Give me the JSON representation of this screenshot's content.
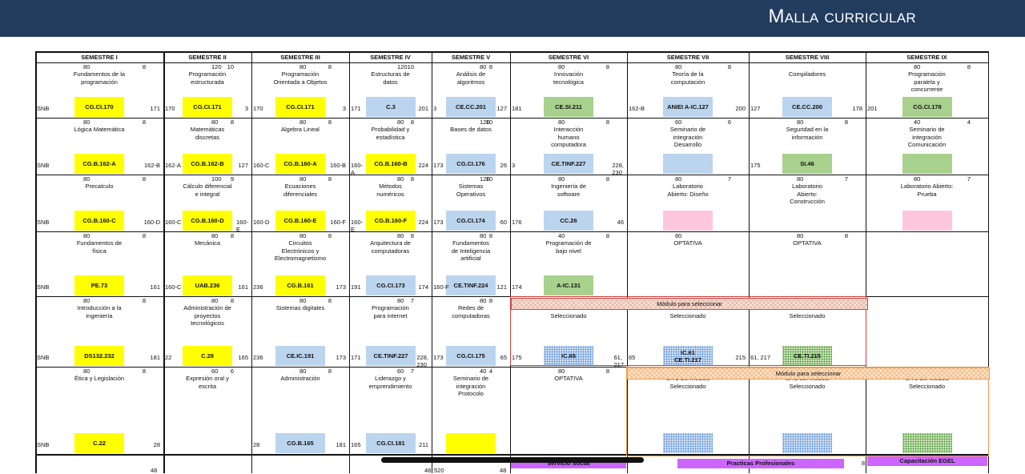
{
  "title": "Malla curricular",
  "colors": {
    "yellow": "#ffff00",
    "blue": "#bcd5ee",
    "green": "#a9d18e",
    "pink": "#ffc7dc",
    "purple": "#cc66ff",
    "header_bg": "#223c5e"
  },
  "headers": [
    "SEMESTRE I",
    "SEMESTRE II",
    "SEMESTRE III",
    "SEMESTRE IV",
    "SEMESTRE V",
    "SEMESTRE VI",
    "SEMESTRE VII",
    "SEMESTRE VIII",
    "SEMESTRE IX"
  ],
  "rows": [
    [
      {
        "hl": "80",
        "hr": "8",
        "name": "Fundamentos de la\nprogramación",
        "code": "CG.CI.170",
        "color": "yellow",
        "bl": "SNB",
        "br": "171"
      },
      {
        "hl": "120",
        "hr": "10",
        "name": "Programación\nestructurada",
        "code": "CG.CI.171",
        "color": "yellow",
        "bl": "170",
        "br": "3"
      },
      {
        "hl": "80",
        "hr": "8",
        "name": "Programación\nOrientada a Objetos",
        "code": "CG.CI.171",
        "color": "yellow",
        "bl": "170",
        "br": "3"
      },
      {
        "hl": "120",
        "hr": "10",
        "name": "Estructuras de\ndatos",
        "code": "C.3",
        "color": "blue",
        "bl": "171",
        "br": "201"
      },
      {
        "hl": "80",
        "hr": "8",
        "name": "Análisis de\nalgoritmos",
        "code": "CE.CC.201",
        "color": "blue",
        "bl": "3",
        "br": "127"
      },
      {
        "hl": "80",
        "hr": "8",
        "name": "Innovación\ntecnológica",
        "code": "CE.SI.211",
        "color": "green",
        "bl": "181",
        "br": ""
      },
      {
        "hl": "80",
        "hr": "8",
        "name": "Teoría de la\ncomputación",
        "code": "ANIEI A-IC.127",
        "color": "blue",
        "bl": "162-B",
        "br": "200"
      },
      {
        "hl": "",
        "hr": "",
        "name": "Compiladores",
        "code": "CE.CC.200",
        "color": "blue",
        "bl": "127",
        "br": "178"
      },
      {
        "hl": "80",
        "hr": "8",
        "name": "Programación\nparalela y\nconcurrente",
        "code": "CG.CI.178",
        "color": "green",
        "bl": "201",
        "br": ""
      }
    ],
    [
      {
        "hl": "80",
        "hr": "8",
        "name": "Lógica Matemática",
        "code": "CG.B.162-A",
        "color": "yellow",
        "bl": "SNB",
        "br": "162-B"
      },
      {
        "hl": "80",
        "hr": "8",
        "name": "Matemáticas\ndiscretas",
        "code": "CG.B.162-B",
        "color": "yellow",
        "bl": "162-A",
        "br": "127"
      },
      {
        "hl": "80",
        "hr": "8",
        "name": "Algebra Lineal",
        "code": "CG.B.160-A",
        "color": "yellow",
        "bl": "160-C",
        "br": "160-B"
      },
      {
        "hl": "80",
        "hr": "8",
        "name": "Probabilidad y\nestadística",
        "code": "CG.B.160-B",
        "color": "yellow",
        "bl": "160-\nA",
        "br": "224"
      },
      {
        "hl": "120",
        "hr": "10",
        "name": "Bases de datos",
        "code": "CG.CI.176",
        "color": "blue",
        "bl": "173",
        "br": "26"
      },
      {
        "hl": "80",
        "hr": "8",
        "name": "Interacción\nhumano\ncomputadora",
        "code": "CE.TINF.227",
        "color": "blue",
        "bl": "3",
        "br": "228,\n230"
      },
      {
        "hl": "60",
        "hr": "6",
        "name": "Seminario de\nintegración\nDesarrollo",
        "code": "",
        "color": "blue",
        "bl": "",
        "br": ""
      },
      {
        "hl": "80",
        "hr": "8",
        "name": "Seguridad en la\ninformación",
        "code": "SI.46",
        "color": "green",
        "bl": "175",
        "br": ""
      },
      {
        "hl": "40",
        "hr": "4",
        "name": "Seminario de\nintegración\nComunicación",
        "code": "",
        "color": "green",
        "bl": "",
        "br": ""
      }
    ],
    [
      {
        "hl": "80",
        "hr": "8",
        "name": "Precalculo",
        "code": "CG.B.160-C",
        "color": "yellow",
        "bl": "SNB",
        "br": "160-D"
      },
      {
        "hl": "100",
        "hr": "9",
        "name": "Cálculo diferencial\ne integral",
        "code": "CG.B.160-D",
        "color": "yellow",
        "bl": "160-C",
        "br": "160-\nE"
      },
      {
        "hl": "80",
        "hr": "8",
        "name": "Ecuaciones\ndiferenciales",
        "code": "CG.B.160-E",
        "color": "yellow",
        "bl": "160-D",
        "br": "160-F"
      },
      {
        "hl": "80",
        "hr": "8",
        "name": "Métodos\nnuméricos",
        "code": "CG.B.160-F",
        "color": "yellow",
        "bl": "160-\nE",
        "br": "224"
      },
      {
        "hl": "120",
        "hr": "10",
        "name": "Sistemas\nOperativos",
        "code": "CG.CI.174",
        "color": "blue",
        "bl": "173",
        "br": "60"
      },
      {
        "hl": "80",
        "hr": "8",
        "name": "Ingeniería de\nsoftware",
        "code": "CC.26",
        "color": "blue",
        "bl": "176",
        "br": "46"
      },
      {
        "hl": "80",
        "hr": "7",
        "name": "Laboratorio\nAbierto: Diseño",
        "code": "",
        "color": "pink",
        "bl": "",
        "br": ""
      },
      {
        "hl": "80",
        "hr": "7",
        "name": "Laboratorio\nAbierto:\nConstrucción",
        "code": "",
        "color": "",
        "bl": "",
        "br": ""
      },
      {
        "hl": "80",
        "hr": "7",
        "name": "Laboratorio Abierto:\nPrueba",
        "code": "",
        "color": "pink",
        "bl": "",
        "br": ""
      }
    ],
    [
      {
        "hl": "80",
        "hr": "8",
        "name": "Fundamentos de\nfísica",
        "code": "PE.73",
        "color": "yellow",
        "bl": "SNB",
        "br": "161"
      },
      {
        "hl": "80",
        "hr": "8",
        "name": "Mecánica",
        "code": "UAB.236",
        "color": "yellow",
        "bl": "160-C",
        "br": "161"
      },
      {
        "hl": "80",
        "hr": "8",
        "name": "Circuitos\nElectrónicos y\nElectromagnetismo",
        "code": "CG.B.161",
        "color": "yellow",
        "bl": "236",
        "br": "173"
      },
      {
        "hl": "80",
        "hr": "8",
        "name": "Arquitectura de\ncomputadoras",
        "code": "CG.CI.173",
        "color": "blue",
        "bl": "191",
        "br": "174"
      },
      {
        "hl": "80",
        "hr": "8",
        "name": "Fundamentos\nde Inteligencia\nartificial",
        "code": "CE.TINF.224",
        "color": "blue",
        "bl": "160-F",
        "br": "121"
      },
      {
        "hl": "40",
        "hr": "8",
        "name": "Programación de\nbajo nivel",
        "code": "A-IC.131",
        "color": "green",
        "bl": "174",
        "br": ""
      },
      {
        "hl": "80",
        "hr": "",
        "name": "OPTATIVA",
        "code": "",
        "color": "",
        "bl": "",
        "br": ""
      },
      {
        "hl": "80",
        "hr": "8",
        "name": "OPTATIVA",
        "code": "",
        "color": "",
        "bl": "",
        "br": ""
      },
      {
        "hl": "",
        "hr": "",
        "name": "",
        "code": "",
        "color": "",
        "bl": "",
        "br": ""
      }
    ],
    [
      {
        "hl": "80",
        "hr": "8",
        "name": "Introducción a la\ningeniería",
        "code": "DS132.232",
        "color": "yellow",
        "bl": "SNB",
        "br": "181"
      },
      {
        "hl": "80",
        "hr": "8",
        "name": "Administración de\nproyectos\ntecnológicos",
        "code": "C.28",
        "color": "yellow",
        "bl": "22",
        "br": "165"
      },
      {
        "hl": "80",
        "hr": "8",
        "name": "Sistemas digitales",
        "code": "CE.IC.191",
        "color": "blue",
        "bl": "236",
        "br": "173"
      },
      {
        "hl": "80",
        "hr": "7",
        "name": "Programación\npara internet",
        "code": "CE.TINF.227",
        "color": "blue",
        "bl": "171",
        "br": "228,\n230"
      },
      {
        "hl": "80",
        "hr": "8",
        "name": "Redes de\ncomputadoras",
        "code": "CG.CI.175",
        "color": "blue",
        "bl": "173",
        "br": "65"
      },
      {
        "hl": "80",
        "hr": "8",
        "name": "UA 1 del Módulo\nSeleccionado",
        "code": "IC.65",
        "color": "dots-blue",
        "bl": "175",
        "br": "61,\n217"
      },
      {
        "hl": "80",
        "hr": "8",
        "name": "UA 2 del Módulo\nSeleccionado",
        "code": "IC.61\nCE.TI.217",
        "color": "dots-blue",
        "bl": "65",
        "br": "215"
      },
      {
        "hl": "80",
        "hr": "8",
        "name": "UA 3 del Módulo\nSeleccionado",
        "code": "CE.TI.215",
        "color": "dots-green",
        "bl": "61, 217",
        "br": ""
      },
      {
        "hl": "",
        "hr": "",
        "name": "",
        "code": "",
        "color": "",
        "bl": "",
        "br": ""
      }
    ],
    [
      {
        "hl": "80",
        "hr": "8",
        "name": "Ética y Legislación",
        "code": "C.22",
        "color": "yellow",
        "bl": "SNB",
        "br": "28"
      },
      {
        "hl": "60",
        "hr": "6",
        "name": "Expresión oral y\nescrita",
        "code": "",
        "color": "",
        "bl": "",
        "br": ""
      },
      {
        "hl": "80",
        "hr": "8",
        "name": "Administración",
        "code": "CG.B.165",
        "color": "blue",
        "bl": "28",
        "br": "181"
      },
      {
        "hl": "60",
        "hr": "7",
        "name": "Liderazgo y\nemprendimiento",
        "code": "CG.CI.181",
        "color": "blue",
        "bl": "165",
        "br": "211"
      },
      {
        "hl": "40",
        "hr": "4",
        "name": "Seminario de\nintegración\nProtocolo",
        "code": "",
        "color": "yellow",
        "bl": "",
        "br": ""
      },
      {
        "hl": "80",
        "hr": "8",
        "name": "OPTATIVA",
        "code": "",
        "color": "",
        "bl": "",
        "br": ""
      },
      {
        "hl": "80",
        "hr": "8",
        "name": "UA 1 del Módulo\nSeleccionado",
        "code": "",
        "color": "dots-blue",
        "bl": "",
        "br": ""
      },
      {
        "hl": "80",
        "hr": "8",
        "name": "UA 2 del Módulo\nSeleccionado",
        "code": "",
        "color": "dots-blue",
        "bl": "",
        "br": ""
      },
      {
        "hl": "80",
        "hr": "8",
        "name": "UA 3 del Módulo\nSeleccionado",
        "code": "",
        "color": "dots-green",
        "bl": "",
        "br": ""
      }
    ]
  ],
  "modules": {
    "label_1": "Módulo para seleccionar",
    "label_2": "Módulo para seleccionar"
  },
  "bottom": {
    "servicio": "Servicio Social",
    "practicas": "Practicas Profesionales",
    "capacitacion": "Capacitación EGEL",
    "n48a": "48",
    "n48b": "48",
    "n520": "520",
    "n48c": "48",
    "n8": "8"
  }
}
